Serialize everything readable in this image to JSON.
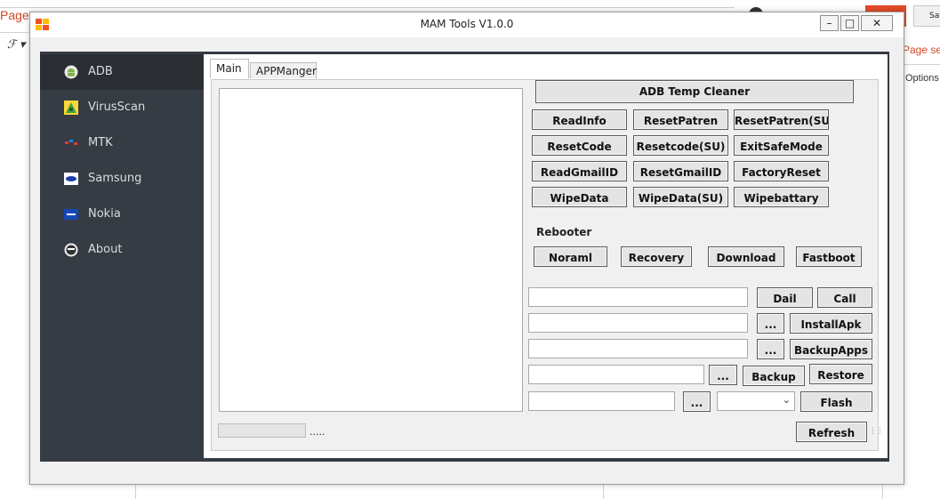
{
  "background_app": {
    "page_tab": "Page",
    "font_button": "ℱ ▾",
    "save_button": "Sav",
    "page_setup": "Page set",
    "options": "Options"
  },
  "window": {
    "title": "MAM Tools V1.0.0",
    "controls": {
      "minimize": "–",
      "maximize": "□",
      "close": "✕"
    }
  },
  "sidebar": {
    "items": [
      {
        "label": "ADB",
        "icon": "android-icon"
      },
      {
        "label": "VirusScan",
        "icon": "virusscan-icon"
      },
      {
        "label": "MTK",
        "icon": "mtk-icon"
      },
      {
        "label": "Samsung",
        "icon": "samsung-icon"
      },
      {
        "label": "Nokia",
        "icon": "nokia-icon"
      },
      {
        "label": "About",
        "icon": "about-icon"
      }
    ]
  },
  "tabs": [
    {
      "label": "Main"
    },
    {
      "label": "APPManger"
    }
  ],
  "main": {
    "adb_temp_cleaner": "ADB Temp Cleaner",
    "grid_buttons": [
      [
        "ReadInfo",
        "ResetPatren",
        "ResetPatren(SU"
      ],
      [
        "ResetCode",
        "Resetcode(SU)",
        "ExitSafeMode"
      ],
      [
        "ReadGmailID",
        "ResetGmailID",
        "FactoryReset"
      ],
      [
        "WipeData",
        "WipeData(SU)",
        "Wipebattary"
      ]
    ],
    "rebooter": {
      "label": "Rebooter",
      "buttons": [
        "Noraml",
        "Recovery",
        "Download",
        "Fastboot"
      ]
    },
    "dial_button": "Dail",
    "call_button": "Call",
    "browse_label": "...",
    "install_apk_button": "InstallApk",
    "backup_apps_button": "BackupApps",
    "backup_button": "Backup",
    "restore_button": "Restore",
    "flash_button": "Flash",
    "refresh_button": "Refresh",
    "status_text": ".....",
    "dial_input": "",
    "apk_path_input": "",
    "backup_apps_path_input": "",
    "backup_path_input": "",
    "flash_path_input": "",
    "flash_select": ""
  },
  "colors": {
    "sidebar_bg": "#363c43",
    "sidebar_active_bg": "#2a2e33",
    "sidebar_text": "#d9dde3",
    "accent_orange": "#d24726"
  }
}
